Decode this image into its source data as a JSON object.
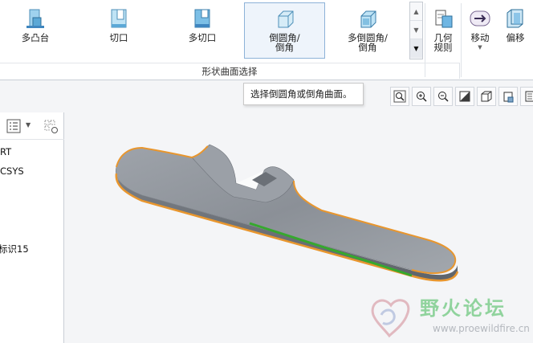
{
  "ribbon": {
    "buttons": {
      "boss": "多凸台",
      "cut": "切口",
      "multicut": "多切口",
      "round_chamfer": "倒圆角/\n倒角",
      "multi_round_chamfer": "多倒圆角/\n倒角",
      "geometry_rule": "几何\n规则",
      "move": "移动",
      "offset": "偏移"
    },
    "group_label": "形状曲面选择"
  },
  "tooltip": "选择倒圆角或倒角曲面。",
  "tree": {
    "items": [
      "RT",
      "CSYS",
      "标识15"
    ]
  },
  "watermark": {
    "title": "野火论坛",
    "url": "www.proewildfire.cn"
  },
  "colors": {
    "part_body": "#8d9299",
    "edge_highlight": "#e8962e",
    "selected_edge": "#36a82e",
    "accent_blue": "#8db2d8"
  }
}
